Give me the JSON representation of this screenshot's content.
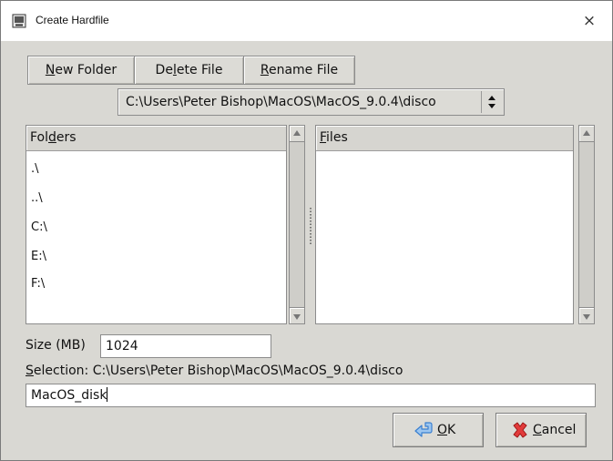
{
  "window": {
    "title": "Create Hardfile",
    "close_glyph": "×"
  },
  "toolbar": {
    "new_folder": {
      "pre": "",
      "mnemonic": "N",
      "post": "ew Folder"
    },
    "delete_file": {
      "pre": "De",
      "mnemonic": "l",
      "post": "ete File"
    },
    "rename_file": {
      "pre": "",
      "mnemonic": "R",
      "post": "ename File"
    }
  },
  "path_combo": {
    "value": "C:\\Users\\Peter Bishop\\MacOS\\MacOS_9.0.4\\disco",
    "arrow_glyph": "⬍"
  },
  "folders_pane": {
    "header": {
      "pre": "Fol",
      "mnemonic": "d",
      "post": "ers"
    },
    "items": [
      ".\\",
      "..\\",
      "C:\\",
      "E:\\",
      "F:\\"
    ]
  },
  "files_pane": {
    "header": {
      "pre": "",
      "mnemonic": "F",
      "post": "iles"
    },
    "items": []
  },
  "size": {
    "label": "Size (MB)",
    "value": "1024"
  },
  "selection": {
    "label_mnemonic": "S",
    "label_rest": "election: C:\\Users\\Peter Bishop\\MacOS\\MacOS_9.0.4\\disco"
  },
  "filename": {
    "value": "MacOS_disk"
  },
  "buttons": {
    "ok": {
      "mnemonic": "O",
      "post": "K",
      "icon": "ok-arrow-icon"
    },
    "cancel": {
      "mnemonic": "C",
      "post": "ancel",
      "icon": "cancel-x-icon"
    }
  },
  "colors": {
    "window_bg": "#d9d8d3",
    "cancel_icon": "#d62020",
    "ok_icon": "#3a7fd0"
  }
}
